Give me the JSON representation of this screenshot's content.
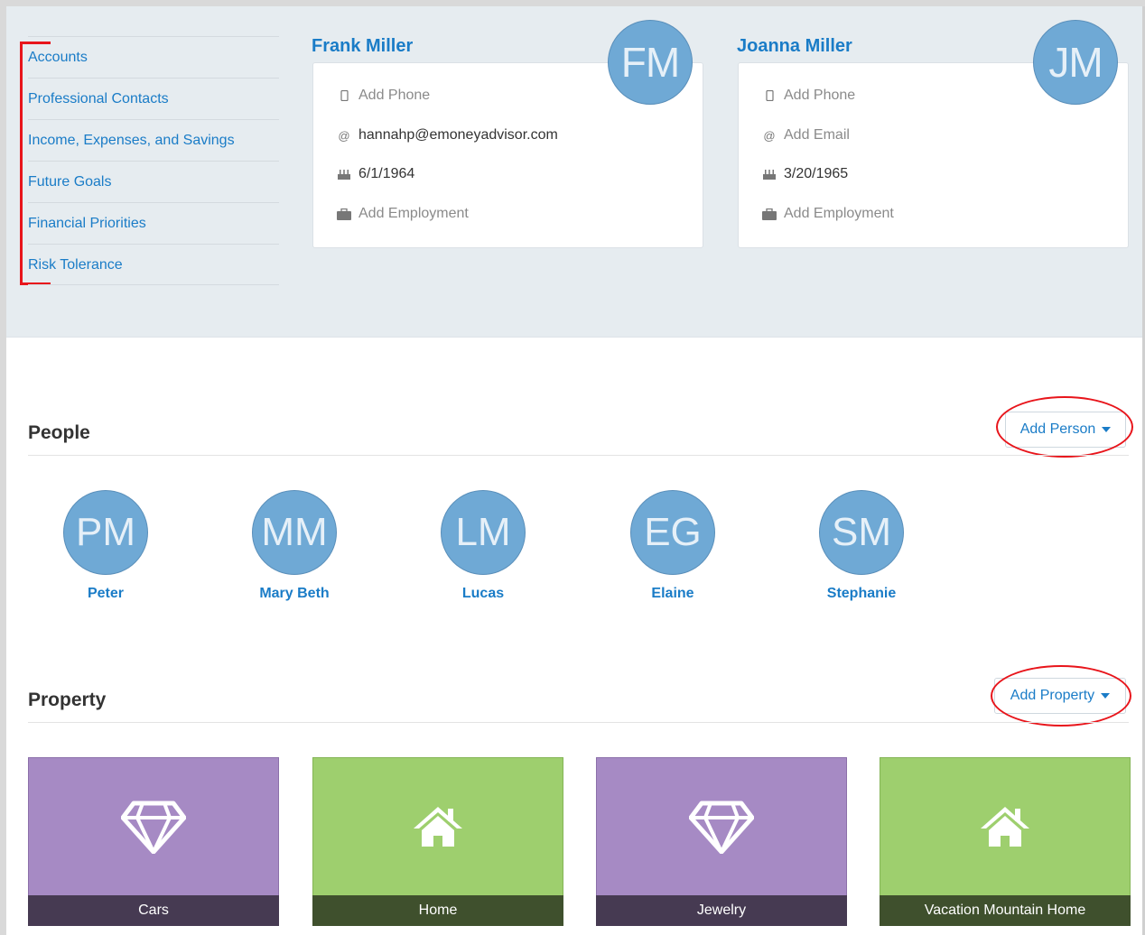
{
  "sidebar": {
    "items": [
      {
        "label": "Accounts"
      },
      {
        "label": "Professional Contacts"
      },
      {
        "label": "Income, Expenses, and Savings"
      },
      {
        "label": "Future Goals"
      },
      {
        "label": "Financial Priorities"
      },
      {
        "label": "Risk Tolerance"
      }
    ]
  },
  "clients": [
    {
      "name": "Frank Miller",
      "initials": "FM",
      "phone": "Add Phone",
      "email": "hannahp@emoneyadvisor.com",
      "birthdate": "6/1/1964",
      "employment": "Add Employment"
    },
    {
      "name": "Joanna Miller",
      "initials": "JM",
      "phone": "Add Phone",
      "email": "Add Email",
      "birthdate": "3/20/1965",
      "employment": "Add Employment"
    }
  ],
  "people_section": {
    "title": "People",
    "add_button": "Add Person",
    "people": [
      {
        "initials": "PM",
        "name": "Peter"
      },
      {
        "initials": "MM",
        "name": "Mary Beth"
      },
      {
        "initials": "LM",
        "name": "Lucas"
      },
      {
        "initials": "EG",
        "name": "Elaine"
      },
      {
        "initials": "SM",
        "name": "Stephanie"
      }
    ]
  },
  "property_section": {
    "title": "Property",
    "add_button": "Add Property",
    "items": [
      {
        "label": "Cars",
        "icon": "diamond-icon",
        "color": "#a68ac4"
      },
      {
        "label": "Home",
        "icon": "house-icon",
        "color": "#9ecf6e"
      },
      {
        "label": "Jewelry",
        "icon": "diamond-icon",
        "color": "#a68ac4"
      },
      {
        "label": "Vacation Mountain Home",
        "icon": "house-icon",
        "color": "#9ecf6e"
      }
    ]
  },
  "colors": {
    "link": "#1a7cc7",
    "avatar": "#6fa9d5",
    "annotation": "#e8151b"
  }
}
